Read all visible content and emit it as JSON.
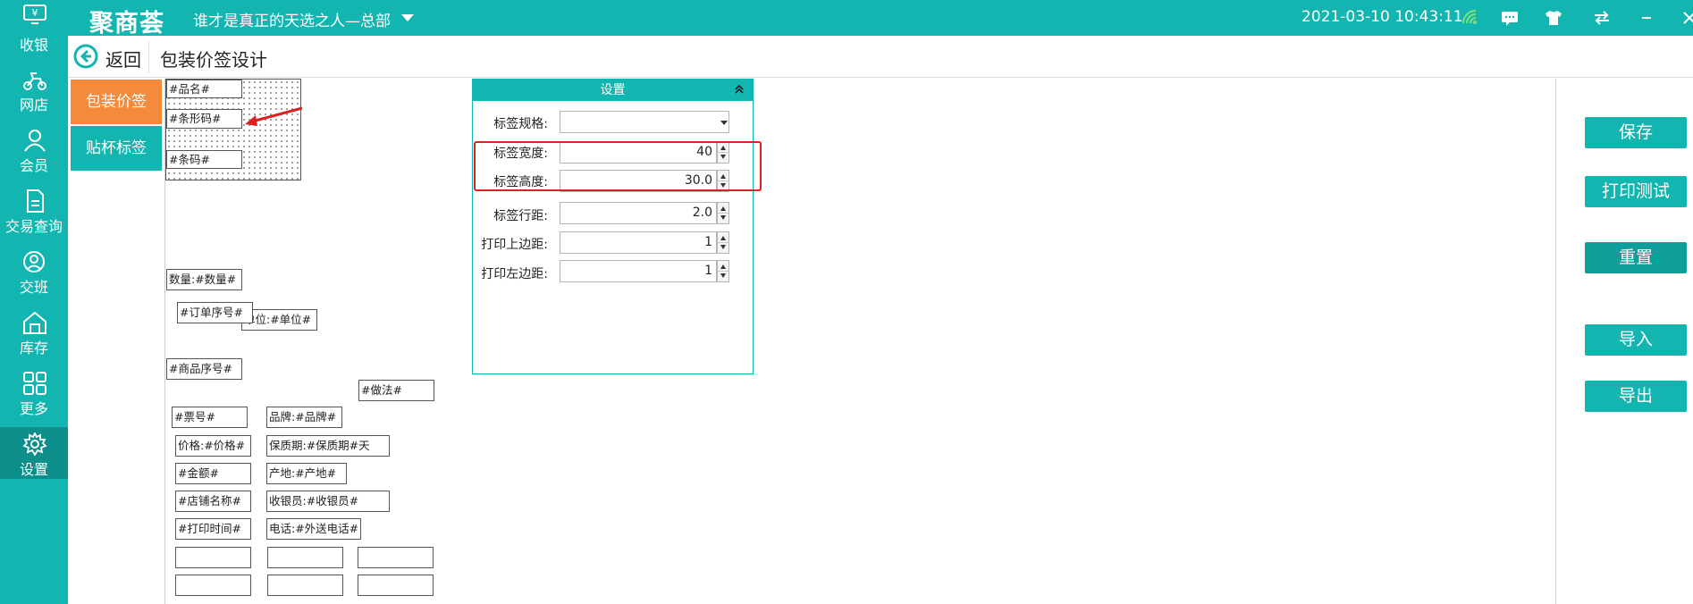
{
  "topbar": {
    "logo": "聚商荟",
    "store_name": "谁才是真正的天选之人—总部",
    "datetime": "2021-03-10 10:43:11",
    "icons": [
      "wifi-icon",
      "message-icon",
      "shirt-icon",
      "switch-icon",
      "minimize-icon",
      "close-icon"
    ]
  },
  "sidebar": {
    "items": [
      {
        "label": "收银",
        "icon": "cashier-icon"
      },
      {
        "label": "网店",
        "icon": "scooter-icon"
      },
      {
        "label": "会员",
        "icon": "member-icon"
      },
      {
        "label": "交易查询",
        "icon": "document-icon"
      },
      {
        "label": "交班",
        "icon": "shift-icon"
      },
      {
        "label": "库存",
        "icon": "warehouse-icon"
      },
      {
        "label": "更多",
        "icon": "grid-icon"
      },
      {
        "label": "设置",
        "icon": "gear-icon"
      }
    ],
    "active": "设置"
  },
  "header": {
    "back_label": "返回",
    "title": "包装价签设计"
  },
  "tabs": [
    {
      "label": "包装价签",
      "active": true,
      "color": "#f58a3c"
    },
    {
      "label": "贴杯标签",
      "active": false,
      "color": "#12b5b0"
    }
  ],
  "label_fields": {
    "name": "#品名#",
    "barcode_img": "#条形码#",
    "barcode": "#条码#"
  },
  "canvas_fields": {
    "qty": "数量:#数量#",
    "order_no": "#订单序号#",
    "unit": "单位:#单位#",
    "goods_no": "#商品序号#",
    "practice": "#做法#",
    "ticket": "#票号#",
    "brand": "品牌:#品牌#",
    "price": "价格:#价格#",
    "shelf": "保质期:#保质期#天",
    "amount": "#金额#",
    "origin": "产地:#产地#",
    "shop": "#店铺名称#",
    "cashier": "收银员:#收银员#",
    "print_time": "#打印时间#",
    "phone": "电话:#外送电话#"
  },
  "settings": {
    "title": "设置",
    "spec_label": "标签规格:",
    "spec_value": "",
    "width_label": "标签宽度:",
    "width_value": "40",
    "height_label": "标签高度:",
    "height_value": "30.0",
    "line_label": "标签行距:",
    "line_value": "2.0",
    "top_label": "打印上边距:",
    "top_value": "1",
    "left_label": "打印左边距:",
    "left_value": "1"
  },
  "actions": {
    "save": "保存",
    "print_test": "打印测试",
    "reset": "重置",
    "import": "导入",
    "export": "导出"
  },
  "colors": {
    "primary": "#12b5b0",
    "accent": "#f58a3c",
    "highlight": "#e02020"
  }
}
